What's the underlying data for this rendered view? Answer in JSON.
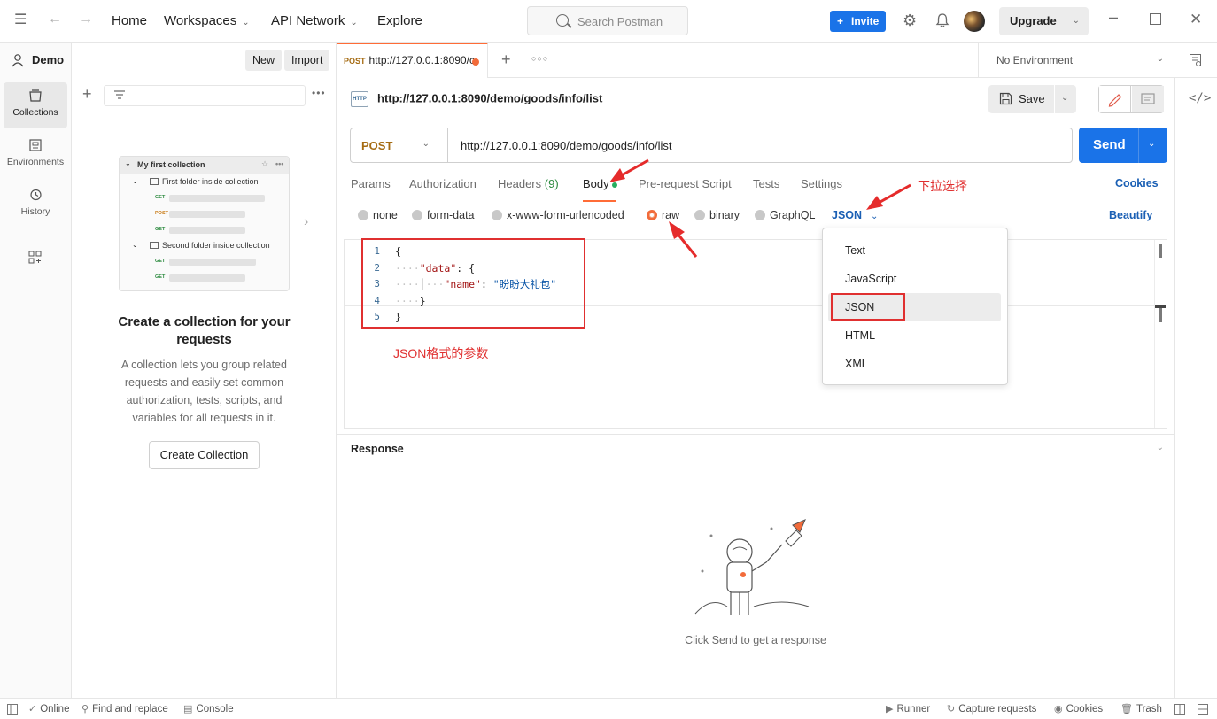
{
  "topbar": {
    "nav": [
      {
        "label": "Home",
        "has_menu": false
      },
      {
        "label": "Workspaces",
        "has_menu": true
      },
      {
        "label": "API Network",
        "has_menu": true
      },
      {
        "label": "Explore",
        "has_menu": false
      }
    ],
    "search_placeholder": "Search Postman",
    "invite_label": "Invite",
    "upgrade_label": "Upgrade"
  },
  "workspace": {
    "name": "Demo",
    "new_label": "New",
    "import_label": "Import"
  },
  "rail": [
    {
      "label": "Collections",
      "icon": "collections-icon",
      "active": true
    },
    {
      "label": "Environments",
      "icon": "environments-icon",
      "active": false
    },
    {
      "label": "History",
      "icon": "history-icon",
      "active": false
    }
  ],
  "sidebar": {
    "preview": {
      "collection": "My first collection",
      "folder1": "First folder inside collection",
      "folder2": "Second folder inside collection",
      "methods": [
        "GET",
        "POST",
        "GET",
        "GET",
        "GET"
      ]
    },
    "empty_title": "Create a collection for your requests",
    "empty_desc": "A collection lets you group related requests and easily set common authorization, tests, scripts, and variables for all requests in it.",
    "create_label": "Create Collection"
  },
  "tab": {
    "method": "POST",
    "title": "http://127.0.0.1:8090/c"
  },
  "environment": {
    "selected": "No Environment"
  },
  "request": {
    "name": "http://127.0.0.1:8090/demo/goods/info/list",
    "save_label": "Save",
    "method": "POST",
    "url": "http://127.0.0.1:8090/demo/goods/info/list",
    "send_label": "Send",
    "tabs": {
      "params": "Params",
      "authorization": "Authorization",
      "headers": "Headers",
      "headers_count": "(9)",
      "body": "Body",
      "prerequest": "Pre-request Script",
      "tests": "Tests",
      "settings": "Settings"
    },
    "cookies_label": "Cookies",
    "body_types": {
      "none": "none",
      "form_data": "form-data",
      "urlencoded": "x-www-form-urlencoded",
      "raw": "raw",
      "binary": "binary",
      "graphql": "GraphQL"
    },
    "selected_body_type": "raw",
    "raw_language": "JSON",
    "beautify_label": "Beautify",
    "code_lines": [
      "1",
      "2",
      "3",
      "4",
      "5"
    ],
    "code": {
      "open": "{",
      "data_key": "\"data\"",
      "name_key": "\"name\"",
      "name_value": "\"盼盼大礼包\"",
      "inner_close": "}",
      "close": "}"
    }
  },
  "language_menu": [
    "Text",
    "JavaScript",
    "JSON",
    "HTML",
    "XML"
  ],
  "annotations": {
    "dropdown_note": "下拉选择",
    "json_note": "JSON格式的参数",
    "color": "#e03030"
  },
  "response": {
    "title": "Response",
    "empty_message": "Click Send to get a response"
  },
  "statusbar": {
    "online": "Online",
    "find_replace": "Find and replace",
    "console": "Console",
    "runner": "Runner",
    "capture": "Capture requests",
    "cookies": "Cookies",
    "trash": "Trash"
  },
  "colors": {
    "accent_orange": "#ff6c37",
    "primary_blue": "#1a73e8",
    "method_post": "#a56b12"
  }
}
